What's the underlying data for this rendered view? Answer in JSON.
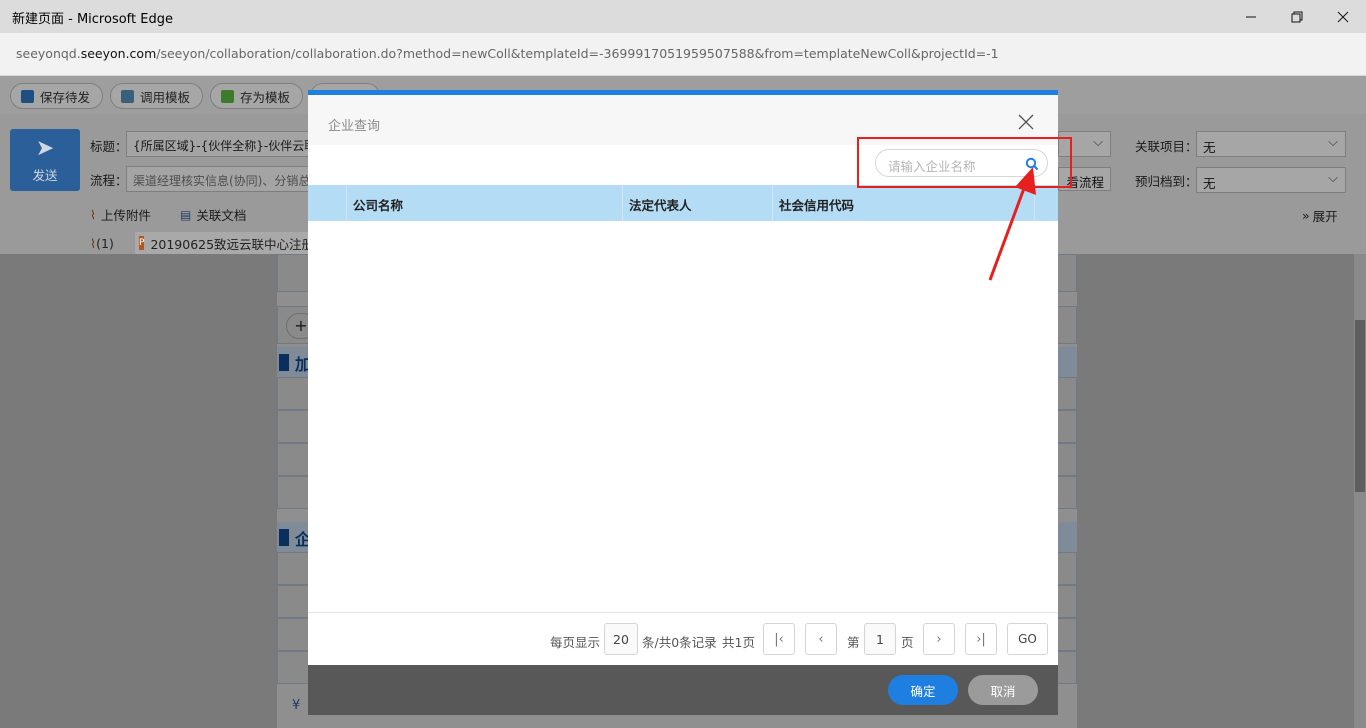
{
  "window": {
    "title": "新建页面 - Microsoft Edge",
    "url_domain_prefix": "seeyonqd.",
    "url_domain_main": "seeyon.com",
    "url_path": "/seeyon/collaboration/collaboration.do?method=newColl&templateId=-3699917051959507588&from=templateNewColl&projectId=-1"
  },
  "toolbar": {
    "save_draft": "保存待发",
    "use_template": "调用模板",
    "save_as_template": "存为模板"
  },
  "form": {
    "send_label": "发送",
    "title_label": "标题：",
    "title_value": "{所属区域}-{伙伴全称}-伙伴云联中心",
    "flow_label": "流程：",
    "flow_placeholder": "渠道经理核实信息(协同)、分销总",
    "related_project_label": "关联项目：",
    "related_project_value": "无",
    "archive_label": "预归档到：",
    "archive_value": "无",
    "view_flow_button": "看流程",
    "upload_attachment": "上传附件",
    "related_doc": "关联文档",
    "expand": "展开",
    "attachment_count": "(1)",
    "attachment_name": "20190625致远云联中心注册"
  },
  "sections": {
    "section1_char": "加",
    "section2_char": "企",
    "add_symbol": "+"
  },
  "modal": {
    "title": "企业查询",
    "search_placeholder": "请输入企业名称",
    "columns": [
      "公司名称",
      "法定代表人",
      "社会信用代码"
    ],
    "pager": {
      "per_page_label": "每页显示",
      "per_page_value": "20",
      "records_text": "条/共0条记录",
      "total_pages_text": "共1页",
      "page_prefix": "第",
      "page_value": "1",
      "page_suffix": "页",
      "go_label": "GO"
    },
    "ok_label": "确定",
    "cancel_label": "取消"
  },
  "colors": {
    "accent": "#1e7fe0",
    "table_header": "#b5dcf5",
    "annotation": "#e5201f",
    "send_button": "#2b5f99"
  }
}
